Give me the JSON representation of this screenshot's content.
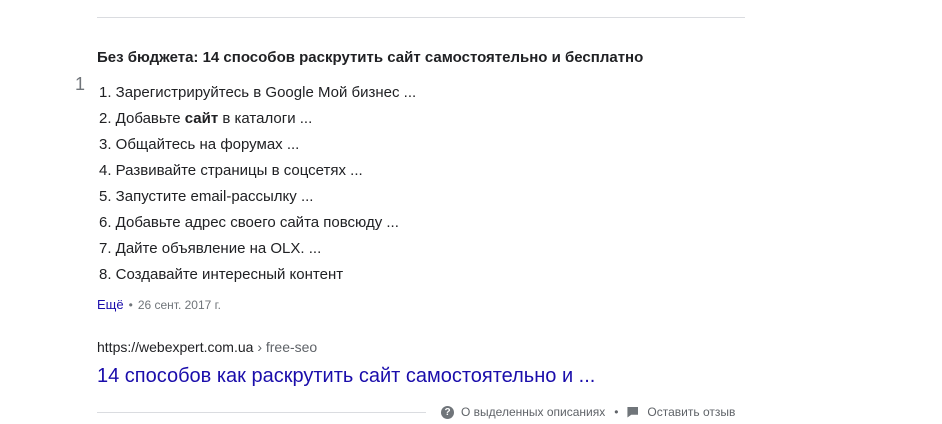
{
  "snippet": {
    "heading": "Без бюджета: 14 способов раскрутить сайт самостоятельно и бесплатно",
    "side_marker": "1",
    "steps": [
      {
        "text": "1. Зарегистрируйтесь в Google Мой бизнес ..."
      },
      {
        "pre": "2. Добавьте ",
        "bold": "сайт",
        "post": " в каталоги ..."
      },
      {
        "text": "3. Общайтесь на форумах ..."
      },
      {
        "text": "4. Развивайте страницы в соцсетях ..."
      },
      {
        "text": "5. Запустите email-рассылку ..."
      },
      {
        "text": "6. Добавьте адрес своего сайта повсюду ..."
      },
      {
        "text": "7. Дайте объявление на OLX. ..."
      },
      {
        "text": "8. Создавайте интересный контент"
      }
    ],
    "more_label": "Ещё",
    "date": "26 сент. 2017 г."
  },
  "result": {
    "cite_url": "https://webexpert.com.ua",
    "cite_path": "› free-seo",
    "title": "14 способов как раскрутить сайт самостоятельно и ..."
  },
  "footer": {
    "about_label": "О выделенных описаниях",
    "feedback_label": "Оставить отзыв",
    "about_icon": "help-circle-icon",
    "feedback_icon": "feedback-flag-icon"
  },
  "colors": {
    "link": "#1a0dab",
    "text": "#202124",
    "muted": "#70757a"
  }
}
